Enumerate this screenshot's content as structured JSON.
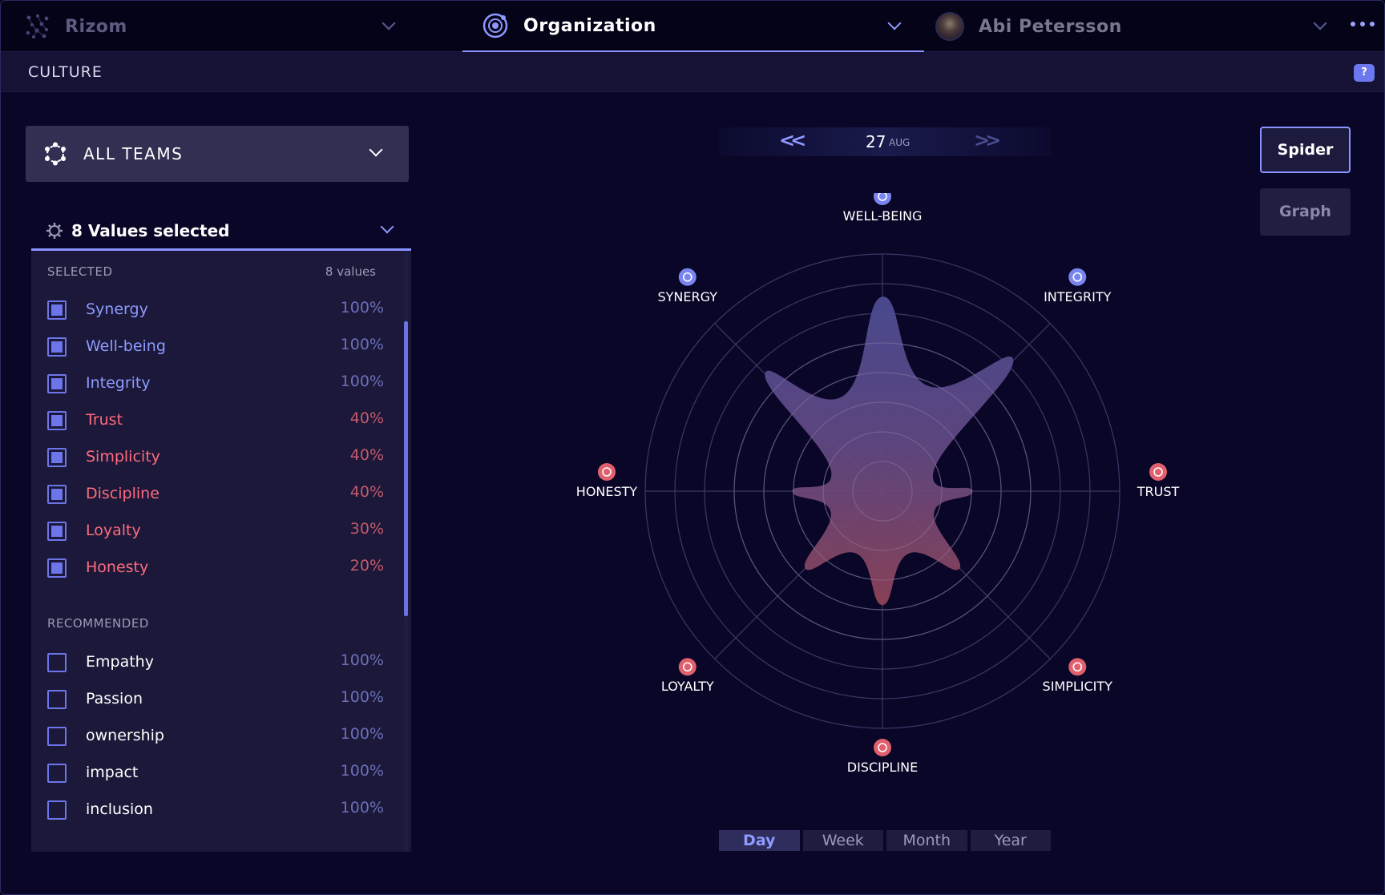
{
  "topbar": {
    "app_name": "Rizom",
    "section_title": "Organization",
    "user_name": "Abi Petersson"
  },
  "subbar": {
    "title": "CULTURE",
    "help_label": "?"
  },
  "teams": {
    "label": "ALL TEAMS"
  },
  "values": {
    "header_label": "8 Values selected",
    "selected_title": "SELECTED",
    "selected_count": "8 values",
    "selected": [
      {
        "label": "Synergy",
        "pct": "100%",
        "tone": "blue"
      },
      {
        "label": "Well-being",
        "pct": "100%",
        "tone": "blue"
      },
      {
        "label": "Integrity",
        "pct": "100%",
        "tone": "blue"
      },
      {
        "label": "Trust",
        "pct": "40%",
        "tone": "red"
      },
      {
        "label": "Simplicity",
        "pct": "40%",
        "tone": "red"
      },
      {
        "label": "Discipline",
        "pct": "40%",
        "tone": "red"
      },
      {
        "label": "Loyalty",
        "pct": "30%",
        "tone": "red"
      },
      {
        "label": "Honesty",
        "pct": "20%",
        "tone": "red"
      }
    ],
    "recommended_title": "RECOMMENDED",
    "recommended": [
      {
        "label": "Empathy",
        "pct": "100%"
      },
      {
        "label": "Passion",
        "pct": "100%"
      },
      {
        "label": "ownership",
        "pct": "100%"
      },
      {
        "label": "impact",
        "pct": "100%"
      },
      {
        "label": "inclusion",
        "pct": "100%"
      }
    ]
  },
  "date": {
    "day": "27",
    "month": "AUG",
    "prev": "<<",
    "next": ">>"
  },
  "modes": {
    "spider": "Spider",
    "graph": "Graph"
  },
  "periods": [
    {
      "label": "Day",
      "active": true
    },
    {
      "label": "Week",
      "active": false
    },
    {
      "label": "Month",
      "active": false
    },
    {
      "label": "Year",
      "active": false
    }
  ],
  "colors": {
    "accent": "#8a93ff",
    "positive": "#8e9bff",
    "negative": "#ff6b7e",
    "background": "#0a0627"
  },
  "chart_data": {
    "type": "radar",
    "axes": [
      "WELL-BEING",
      "INTEGRITY",
      "TRUST",
      "SIMPLICITY",
      "DISCIPLINE",
      "LOYALTY",
      "HONESTY",
      "SYNERGY"
    ],
    "values": [
      0.82,
      0.78,
      0.38,
      0.46,
      0.48,
      0.46,
      0.38,
      0.7
    ],
    "range": [
      0,
      1
    ],
    "rings": 8,
    "axis_icons": [
      "lotus-icon",
      "scales-icon",
      "handshake-icon",
      "hourglass-icon",
      "meditation-icon",
      "heart-hand-icon",
      "candle-icon",
      "swirl-icon"
    ],
    "axis_tones": [
      "blue",
      "blue",
      "red",
      "red",
      "red",
      "red",
      "red",
      "blue"
    ]
  }
}
